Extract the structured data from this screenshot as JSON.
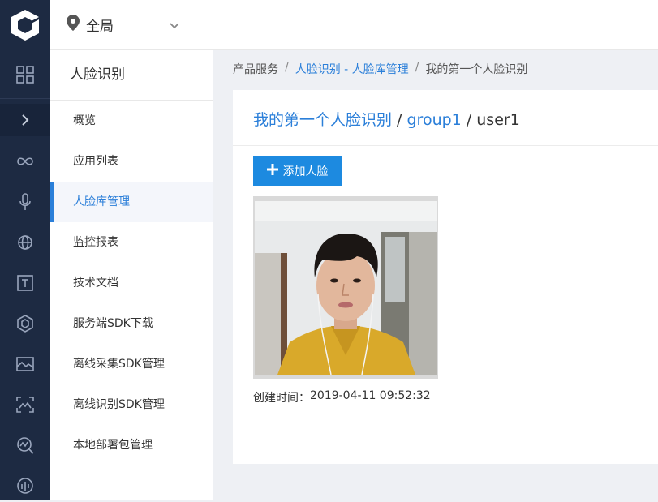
{
  "topbar": {
    "region_label": "全局",
    "region_icon": "location-pin-icon",
    "chevron": "chevron-down-icon"
  },
  "rail": {
    "icons": [
      "grid-icon",
      "expand-arrow-icon",
      "infinity-icon",
      "microphone-icon",
      "globe-icon",
      "text-t-icon",
      "cube-icon",
      "image-icon",
      "face-scan-icon",
      "chart-search-icon",
      "audio-icon"
    ]
  },
  "sidebar": {
    "title": "人脸识别",
    "items": [
      {
        "label": "概览"
      },
      {
        "label": "应用列表"
      },
      {
        "label": "人脸库管理"
      },
      {
        "label": "监控报表"
      },
      {
        "label": "技术文档"
      },
      {
        "label": "服务端SDK下载"
      },
      {
        "label": "离线采集SDK管理"
      },
      {
        "label": "离线识别SDK管理"
      },
      {
        "label": "本地部署包管理"
      }
    ],
    "active_index": 2
  },
  "breadcrumb": {
    "root": "产品服务",
    "sep": "/",
    "link": "人脸识别 - 人脸库管理",
    "current": "我的第一个人脸识别"
  },
  "panel": {
    "title_app": "我的第一个人脸识别",
    "title_sep": " / ",
    "title_group": "group1",
    "title_user": "user1",
    "add_button": "添加人脸",
    "created_label": "创建时间：",
    "created_value": "2019-04-11 09:52:32"
  },
  "colors": {
    "accent": "#2b7fd9",
    "button": "#1d8ae0",
    "rail": "#1d2a42"
  }
}
